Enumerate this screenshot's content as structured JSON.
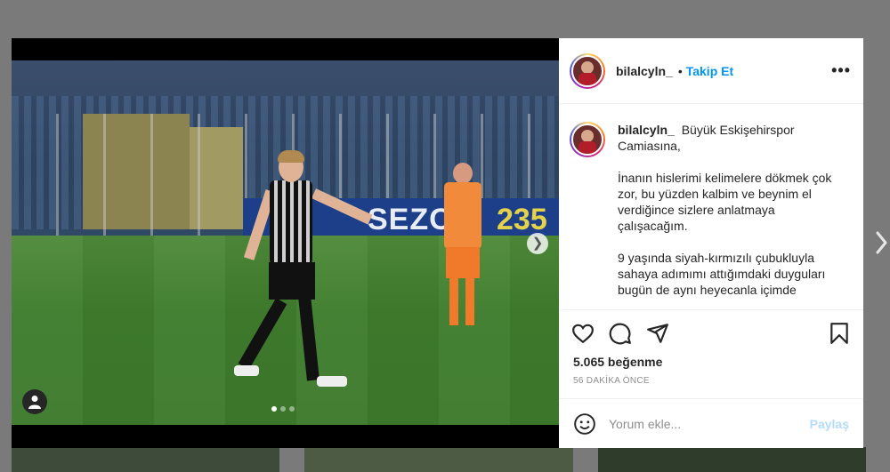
{
  "post": {
    "username": "bilalcyln_",
    "follow_label": "Takip Et",
    "more_label": "•••",
    "caption_paragraphs": [
      "Büyük Eskişehirspor Camiasına,",
      "İnanın hislerimi kelimelere dökmek çok zor, bu yüzden kalbim ve beynim el verdiğince sizlere anlatmaya çalışacağım.",
      "9 yaşında siyah-kırmızılı çubukluyla sahaya adımımı attığımdaki duyguları bugün de aynı heyecanla içimde"
    ],
    "likes": "5.065 beğenme",
    "time_ago": "56 DAKİKA ÖNCE",
    "comment_placeholder": "Yorum ekle...",
    "post_label": "Paylaş",
    "media": {
      "ad_text": "SEZO",
      "ad_number": "235",
      "carousel_count": 3,
      "carousel_active": 0
    }
  },
  "colors": {
    "accent": "#0095f6",
    "post_disabled": "#b3dbff",
    "overlay": "#7a7a7a"
  },
  "icons": [
    "heart-icon",
    "comment-icon",
    "share-icon",
    "bookmark-icon",
    "emoji-icon",
    "user-tag-icon",
    "chevron-right-icon",
    "more-icon"
  ]
}
